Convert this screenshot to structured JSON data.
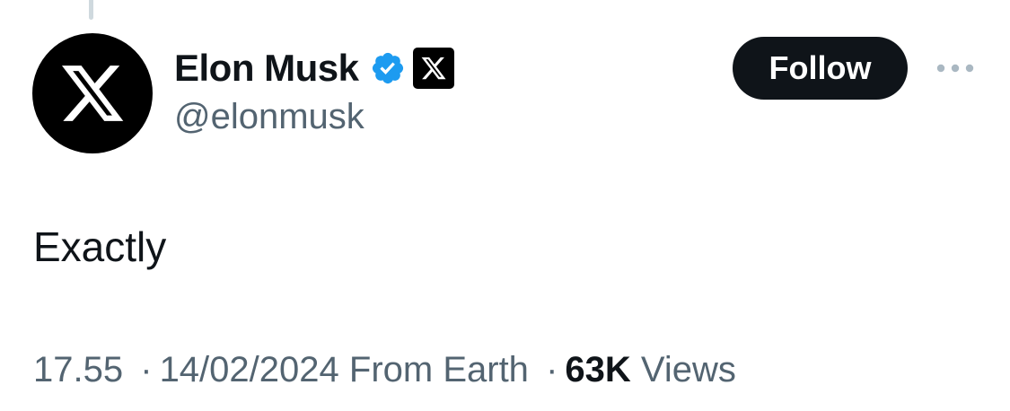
{
  "tweet": {
    "author": {
      "display_name": "Elon Musk",
      "handle": "@elonmusk",
      "verified_icon": "verified-badge-icon",
      "affiliate_icon": "x-logo-icon",
      "avatar_icon": "x-logo-icon"
    },
    "follow_label": "Follow",
    "more_icon": "more-horizontal-icon",
    "text": "Exactly",
    "meta": {
      "time": "17.55",
      "separator": "·",
      "date": "14/02/2024",
      "source": "From Earth",
      "views_count": "63K",
      "views_label": "Views"
    }
  },
  "colors": {
    "text_primary": "#0f1419",
    "text_secondary": "#536471",
    "verified_blue": "#1d9bf0",
    "thread_line": "#cfd9de",
    "follow_bg": "#0f1419"
  }
}
